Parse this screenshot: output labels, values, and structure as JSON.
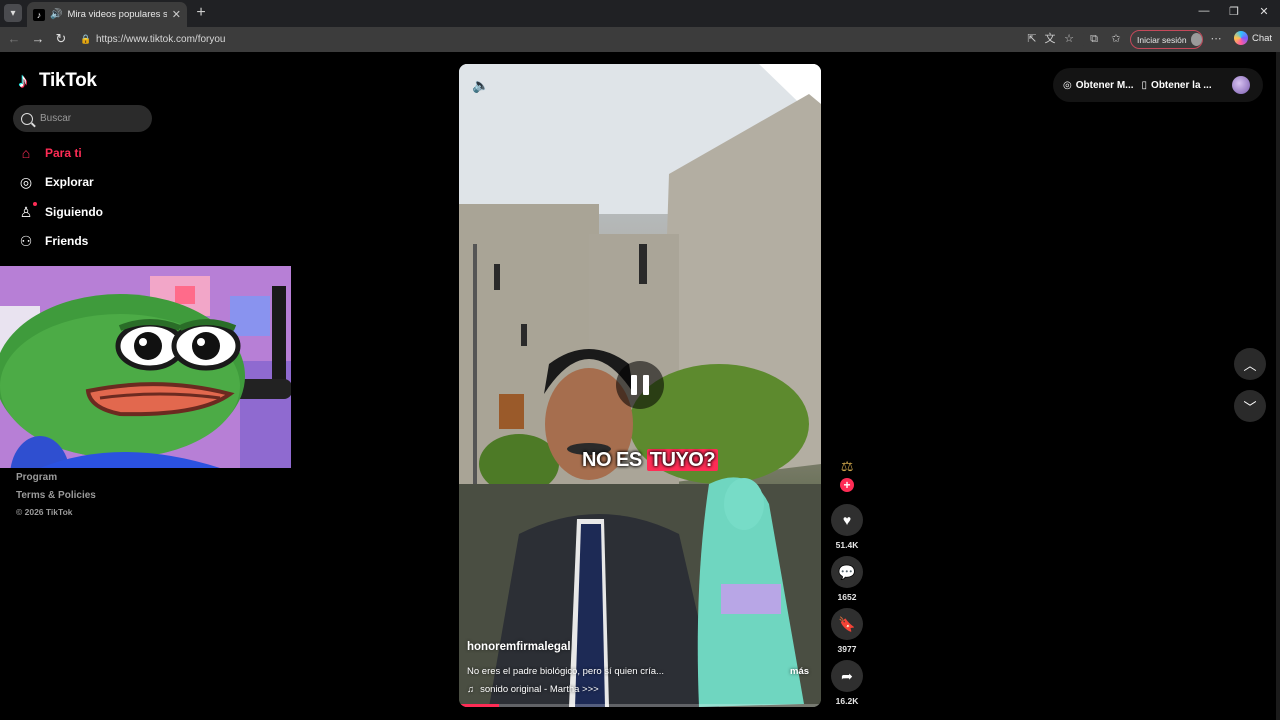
{
  "browser": {
    "tab_title": "Mira videos populares selecci",
    "url": "https://www.tiktok.com/foryou",
    "signin_label": "Iniciar sesión",
    "chat_label": "Chat"
  },
  "brand": {
    "name": "TikTok"
  },
  "search": {
    "placeholder": "Buscar"
  },
  "nav": {
    "for_you": "Para ti",
    "explore": "Explorar",
    "following": "Siguiendo",
    "friends": "Friends"
  },
  "footer": {
    "program": "Program",
    "terms": "Terms & Policies",
    "copyright": "© 2026 TikTok"
  },
  "video": {
    "overlay_text_1": "NO ES ",
    "overlay_text_2": "TUYO?",
    "author": "honoremfirmalegal",
    "description": "No eres el padre biológico, pero sí quien cría...",
    "more": "más",
    "music": "sonido original - Martha >>>",
    "progress": 0.11
  },
  "actions": {
    "likes": "51.4K",
    "comments": "1652",
    "saves": "3977",
    "shares": "16.2K"
  },
  "topbar": {
    "get_coins": "Obtener M...",
    "get_app": "Obtener la ..."
  },
  "colors": {
    "accent": "#fe2c55",
    "background": "#000000"
  }
}
